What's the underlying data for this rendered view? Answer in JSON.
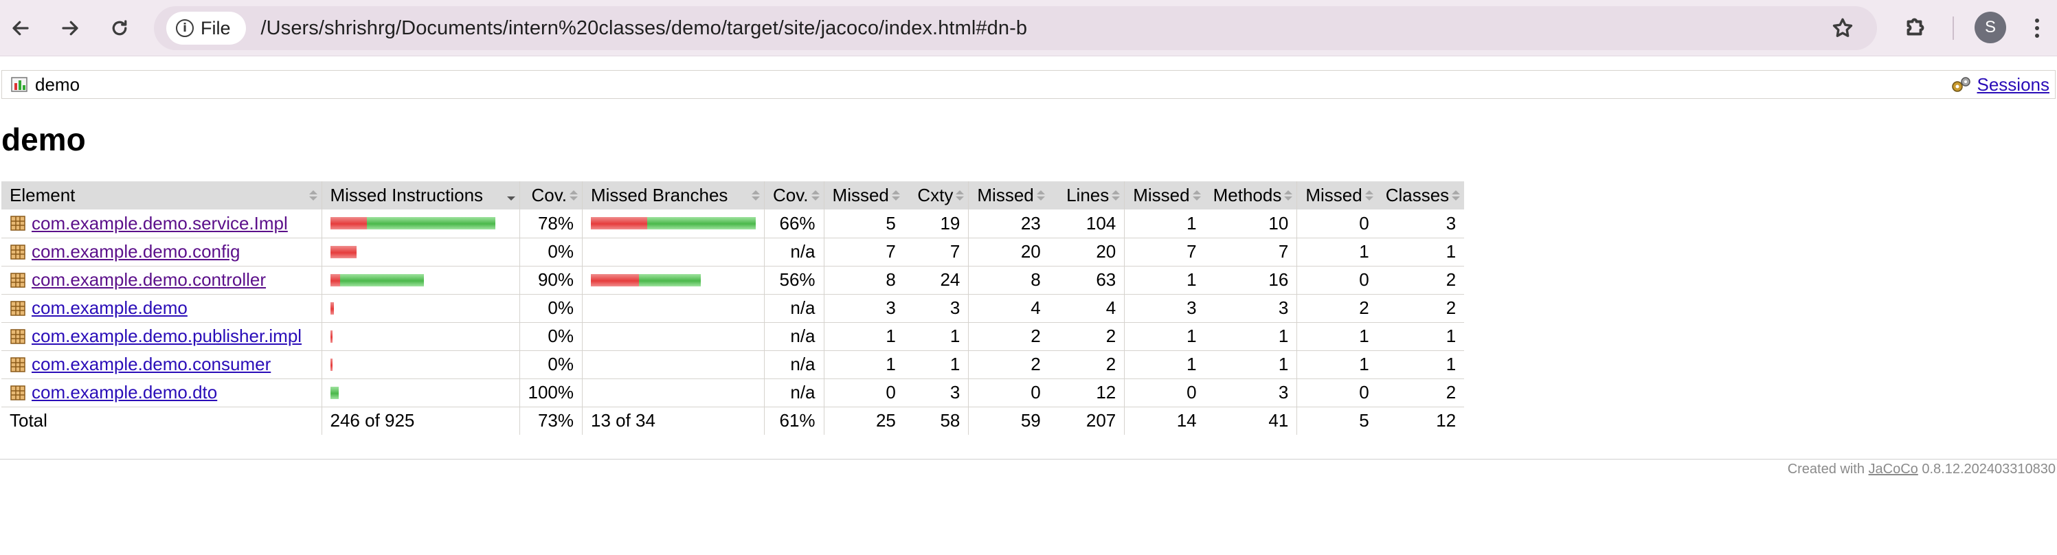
{
  "browser": {
    "chip_label": "File",
    "url": "/Users/shrishrg/Documents/intern%20classes/demo/target/site/jacoco/index.html#dn-b",
    "avatar_letter": "S"
  },
  "breadcrumb": {
    "label": "demo",
    "sessions_label": "Sessions"
  },
  "page_title": "demo",
  "table": {
    "headers": [
      "Element",
      "Missed Instructions",
      "Cov.",
      "Missed Branches",
      "Cov.",
      "Missed",
      "Cxty",
      "Missed",
      "Lines",
      "Missed",
      "Methods",
      "Missed",
      "Classes"
    ],
    "sorted_column": 1,
    "rows": [
      {
        "name": "com.example.demo.service.Impl",
        "visited": true,
        "instr_missed_fraction": 0.22,
        "instr_cov": "78%",
        "branch_missed_fraction": 0.34,
        "branch_cov": "66%",
        "cxty_missed": "5",
        "cxty": "19",
        "lines_missed": "23",
        "lines": "104",
        "methods_missed": "1",
        "methods": "10",
        "classes_missed": "0",
        "classes": "3",
        "instr_total": 255,
        "branch_total": 24
      },
      {
        "name": "com.example.demo.config",
        "visited": true,
        "instr_missed_fraction": 1.0,
        "instr_cov": "0%",
        "branch_missed_fraction": null,
        "branch_cov": "n/a",
        "cxty_missed": "7",
        "cxty": "7",
        "lines_missed": "20",
        "lines": "20",
        "methods_missed": "7",
        "methods": "7",
        "classes_missed": "1",
        "classes": "1",
        "instr_total": 40,
        "branch_total": 0
      },
      {
        "name": "com.example.demo.controller",
        "visited": true,
        "instr_missed_fraction": 0.1,
        "instr_cov": "90%",
        "branch_missed_fraction": 0.44,
        "branch_cov": "56%",
        "cxty_missed": "8",
        "cxty": "24",
        "lines_missed": "8",
        "lines": "63",
        "methods_missed": "1",
        "methods": "16",
        "classes_missed": "0",
        "classes": "2",
        "instr_total": 145,
        "branch_total": 16
      },
      {
        "name": "com.example.demo",
        "visited": false,
        "instr_missed_fraction": 1.0,
        "instr_cov": "0%",
        "branch_missed_fraction": null,
        "branch_cov": "n/a",
        "cxty_missed": "3",
        "cxty": "3",
        "lines_missed": "4",
        "lines": "4",
        "methods_missed": "3",
        "methods": "3",
        "classes_missed": "2",
        "classes": "2",
        "instr_total": 5,
        "branch_total": 0
      },
      {
        "name": "com.example.demo.publisher.impl",
        "visited": false,
        "instr_missed_fraction": 1.0,
        "instr_cov": "0%",
        "branch_missed_fraction": null,
        "branch_cov": "n/a",
        "cxty_missed": "1",
        "cxty": "1",
        "lines_missed": "2",
        "lines": "2",
        "methods_missed": "1",
        "methods": "1",
        "classes_missed": "1",
        "classes": "1",
        "instr_total": 3,
        "branch_total": 0
      },
      {
        "name": "com.example.demo.consumer",
        "visited": false,
        "instr_missed_fraction": 1.0,
        "instr_cov": "0%",
        "branch_missed_fraction": null,
        "branch_cov": "n/a",
        "cxty_missed": "1",
        "cxty": "1",
        "lines_missed": "2",
        "lines": "2",
        "methods_missed": "1",
        "methods": "1",
        "classes_missed": "1",
        "classes": "1",
        "instr_total": 3,
        "branch_total": 0
      },
      {
        "name": "com.example.demo.dto",
        "visited": false,
        "instr_missed_fraction": 0.0,
        "instr_cov": "100%",
        "branch_missed_fraction": null,
        "branch_cov": "n/a",
        "cxty_missed": "0",
        "cxty": "3",
        "lines_missed": "0",
        "lines": "12",
        "methods_missed": "0",
        "methods": "3",
        "classes_missed": "0",
        "classes": "2",
        "instr_total": 13,
        "branch_total": 0
      }
    ],
    "total": {
      "label": "Total",
      "instr": "246 of 925",
      "instr_cov": "73%",
      "branch": "13 of 34",
      "branch_cov": "61%",
      "cxty_missed": "25",
      "cxty": "58",
      "lines_missed": "59",
      "lines": "207",
      "methods_missed": "14",
      "methods": "41",
      "classes_missed": "5",
      "classes": "12"
    }
  },
  "footer": {
    "prefix": "Created with",
    "link": "JaCoCo",
    "version": "0.8.12.202403310830"
  },
  "colors": {
    "bar_missed": "#e63c3c",
    "bar_covered": "#4bb84b",
    "link": "#2a0db8",
    "link_visited": "#5b0f8a",
    "header_bg": "#dcdcdc"
  }
}
